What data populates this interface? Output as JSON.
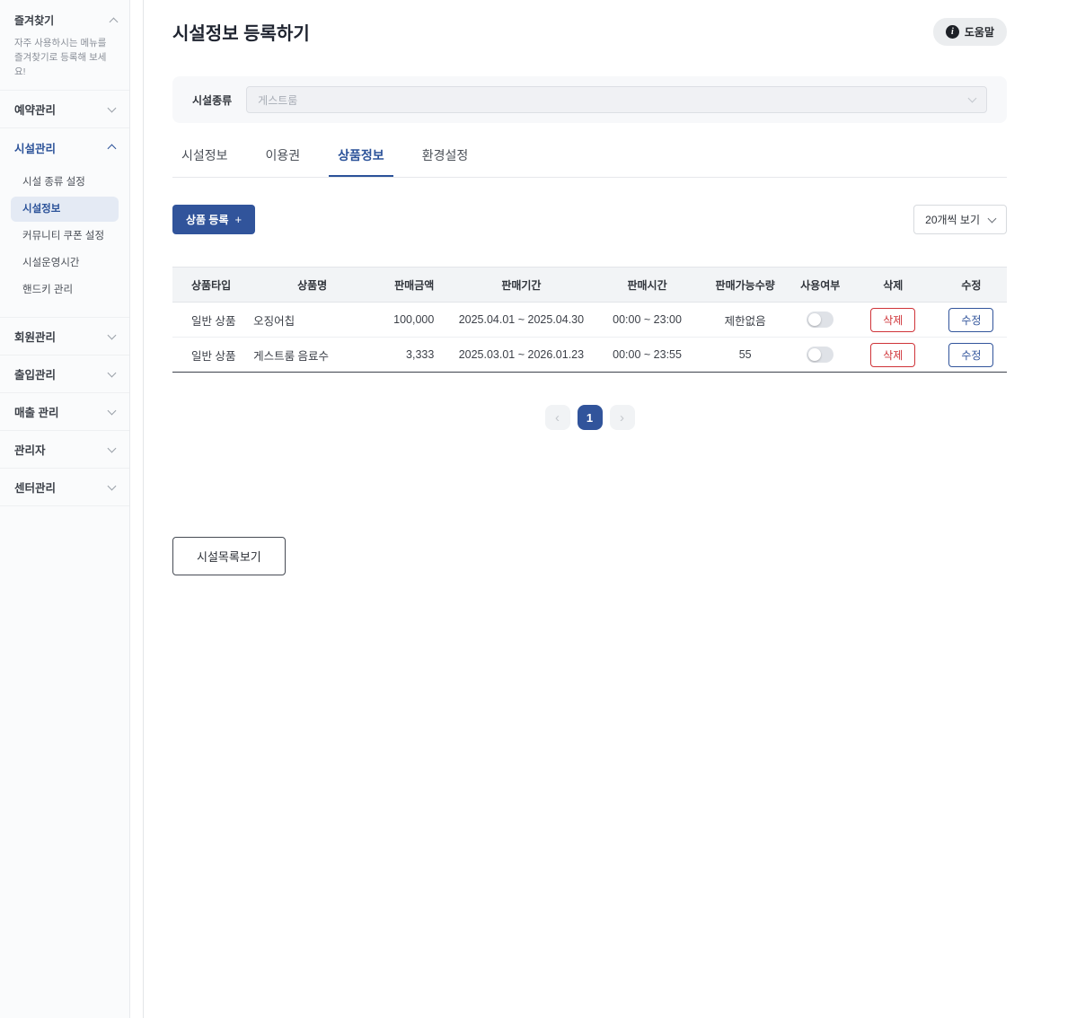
{
  "sidebar": {
    "favorites": {
      "title": "즐겨찾기",
      "hint": "자주 사용하시는 메뉴를 즐겨찾기로 등록해 보세요!"
    },
    "menus": [
      {
        "label": "예약관리",
        "expanded": false
      },
      {
        "label": "시설관리",
        "expanded": true,
        "children": [
          "시설 종류 설정",
          "시설정보",
          "커뮤니티 쿠폰 설정",
          "시설운영시간",
          "핸드키 관리"
        ],
        "active_child": "시설정보"
      },
      {
        "label": "회원관리",
        "expanded": false
      },
      {
        "label": "출입관리",
        "expanded": false
      },
      {
        "label": "매출 관리",
        "expanded": false
      },
      {
        "label": "관리자",
        "expanded": false
      },
      {
        "label": "센터관리",
        "expanded": false
      }
    ]
  },
  "header": {
    "title": "시설정보 등록하기",
    "help_label": "도움말",
    "help_icon": "i"
  },
  "filter": {
    "label": "시설종류",
    "value": "게스트룸"
  },
  "tabs": [
    {
      "label": "시설정보",
      "active": false
    },
    {
      "label": "이용권",
      "active": false
    },
    {
      "label": "상품정보",
      "active": true
    },
    {
      "label": "환경설정",
      "active": false
    }
  ],
  "toolbar": {
    "add_button": "상품 등록",
    "add_icon": "+",
    "page_size": "20개씩 보기"
  },
  "table": {
    "headers": [
      "상품타입",
      "상품명",
      "판매금액",
      "판매기간",
      "판매시간",
      "판매가능수량",
      "사용여부",
      "삭제",
      "수정"
    ],
    "rows": [
      {
        "type": "일반 상품",
        "name": "오징어칩",
        "price": "100,000",
        "period": "2025.04.01 ~ 2025.04.30",
        "time": "00:00 ~ 23:00",
        "qty": "제한없음",
        "enabled": false,
        "delete_label": "삭제",
        "edit_label": "수정"
      },
      {
        "type": "일반 상품",
        "name": "게스트룸 음료수",
        "price": "3,333",
        "period": "2025.03.01 ~ 2026.01.23",
        "time": "00:00 ~ 23:55",
        "qty": "55",
        "enabled": false,
        "delete_label": "삭제",
        "edit_label": "수정"
      }
    ]
  },
  "pagination": {
    "prev_icon": "‹",
    "current": "1",
    "next_icon": "›"
  },
  "footer": {
    "list_button": "시설목록보기"
  },
  "colors": {
    "accent": "#31549b",
    "danger": "#cf3338"
  }
}
